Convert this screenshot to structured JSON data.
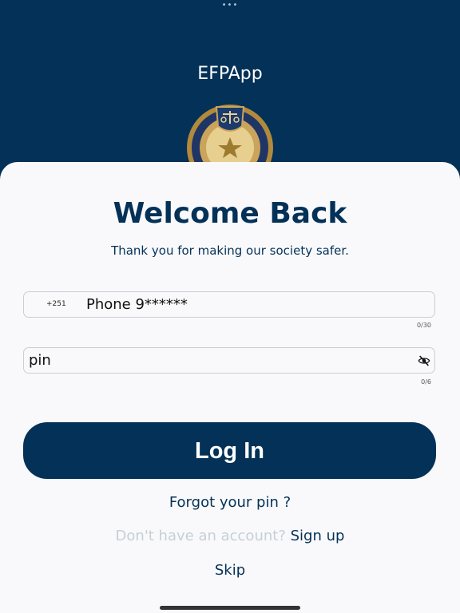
{
  "statusbar": {
    "dots": "•••"
  },
  "header": {
    "title": "EFPApp",
    "emblem_icon": "police-emblem-icon"
  },
  "login": {
    "heading": "Welcome Back",
    "subtitle": "Thank you for making our society safer.",
    "phone": {
      "prefix": "+251",
      "value": "Phone 9******",
      "counter": "0/30"
    },
    "pin": {
      "value": "pin",
      "counter": "0/6",
      "toggle_icon": "eye-off-icon"
    },
    "login_label": "Log In",
    "forgot_label": "Forgot your pin ?",
    "signup_prompt": "Don't have an account?",
    "signup_label": "Sign up",
    "skip_label": "Skip"
  },
  "colors": {
    "primary": "#033157",
    "background": "#f9f9fb",
    "muted": "#c6cfd8"
  }
}
